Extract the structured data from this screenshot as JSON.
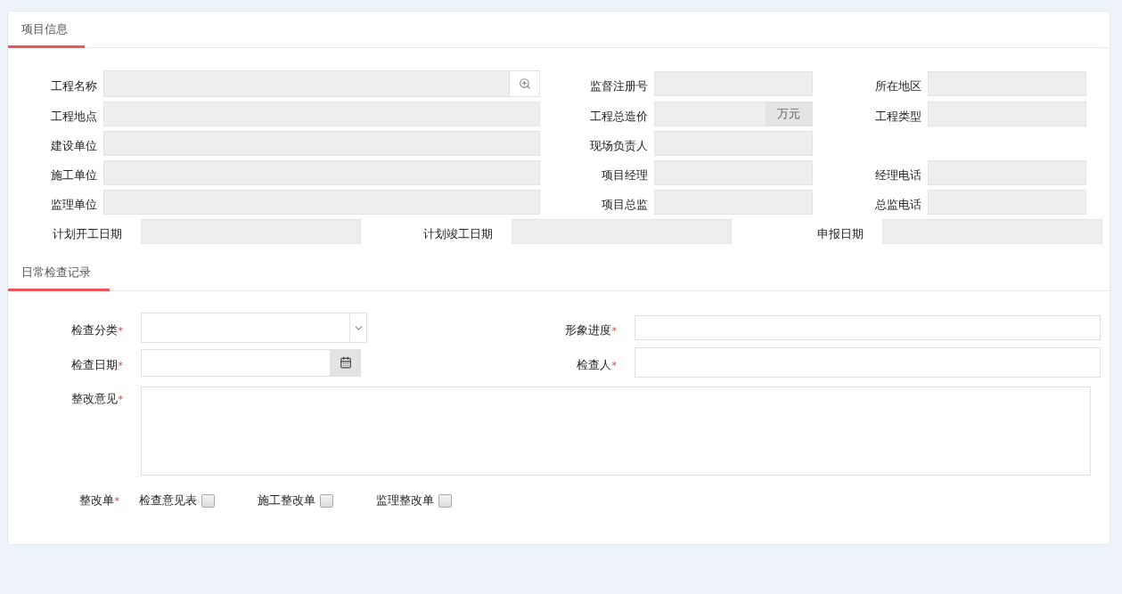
{
  "project_info": {
    "title": "项目信息",
    "rows": [
      [
        {
          "label": "工程名称",
          "kind": "lookup",
          "disabled": true
        },
        {
          "label": "监督注册号",
          "kind": "text",
          "disabled": true
        },
        {
          "label": "所在地区",
          "kind": "text",
          "disabled": true
        }
      ],
      [
        {
          "label": "工程地点",
          "kind": "text",
          "disabled": true
        },
        {
          "label": "工程总造价",
          "kind": "unit",
          "unit": "万元",
          "disabled": true
        },
        {
          "label": "工程类型",
          "kind": "text",
          "disabled": true
        }
      ],
      [
        {
          "label": "建设单位",
          "kind": "text",
          "disabled": true
        },
        {
          "label": "现场负责人",
          "kind": "text",
          "disabled": true
        }
      ],
      [
        {
          "label": "施工单位",
          "kind": "text",
          "disabled": true
        },
        {
          "label": "项目经理",
          "kind": "text",
          "disabled": true
        },
        {
          "label": "经理电话",
          "kind": "text",
          "disabled": true
        }
      ],
      [
        {
          "label": "监理单位",
          "kind": "text",
          "disabled": true
        },
        {
          "label": "项目总监",
          "kind": "text",
          "disabled": true
        },
        {
          "label": "总监电话",
          "kind": "text",
          "disabled": true
        }
      ]
    ],
    "date_row": [
      {
        "label": "计划开工日期",
        "kind": "text",
        "disabled": true
      },
      {
        "label": "计划竣工日期",
        "kind": "text",
        "disabled": true
      },
      {
        "label": "申报日期",
        "kind": "text",
        "disabled": true
      }
    ]
  },
  "inspection": {
    "title": "日常检查记录",
    "rows": [
      [
        {
          "label": "检查分类",
          "required_mark": "*",
          "kind": "select",
          "disabled": false
        },
        {
          "label": "形象进度",
          "required_mark": "*",
          "kind": "text",
          "disabled": false
        }
      ],
      [
        {
          "label": "检查日期",
          "required_mark": "*",
          "kind": "date",
          "disabled": false
        },
        {
          "label": "检查人",
          "required_mark": "*",
          "kind": "text",
          "disabled": false
        }
      ]
    ],
    "remark": {
      "label": "整改意见",
      "required_mark": "*"
    },
    "forms": {
      "label": "整改单",
      "required_mark": "*",
      "options": [
        {
          "label": "检查意见表",
          "checked": false
        },
        {
          "label": "施工整改单",
          "checked": false
        },
        {
          "label": "监理整改单",
          "checked": false
        }
      ]
    }
  }
}
